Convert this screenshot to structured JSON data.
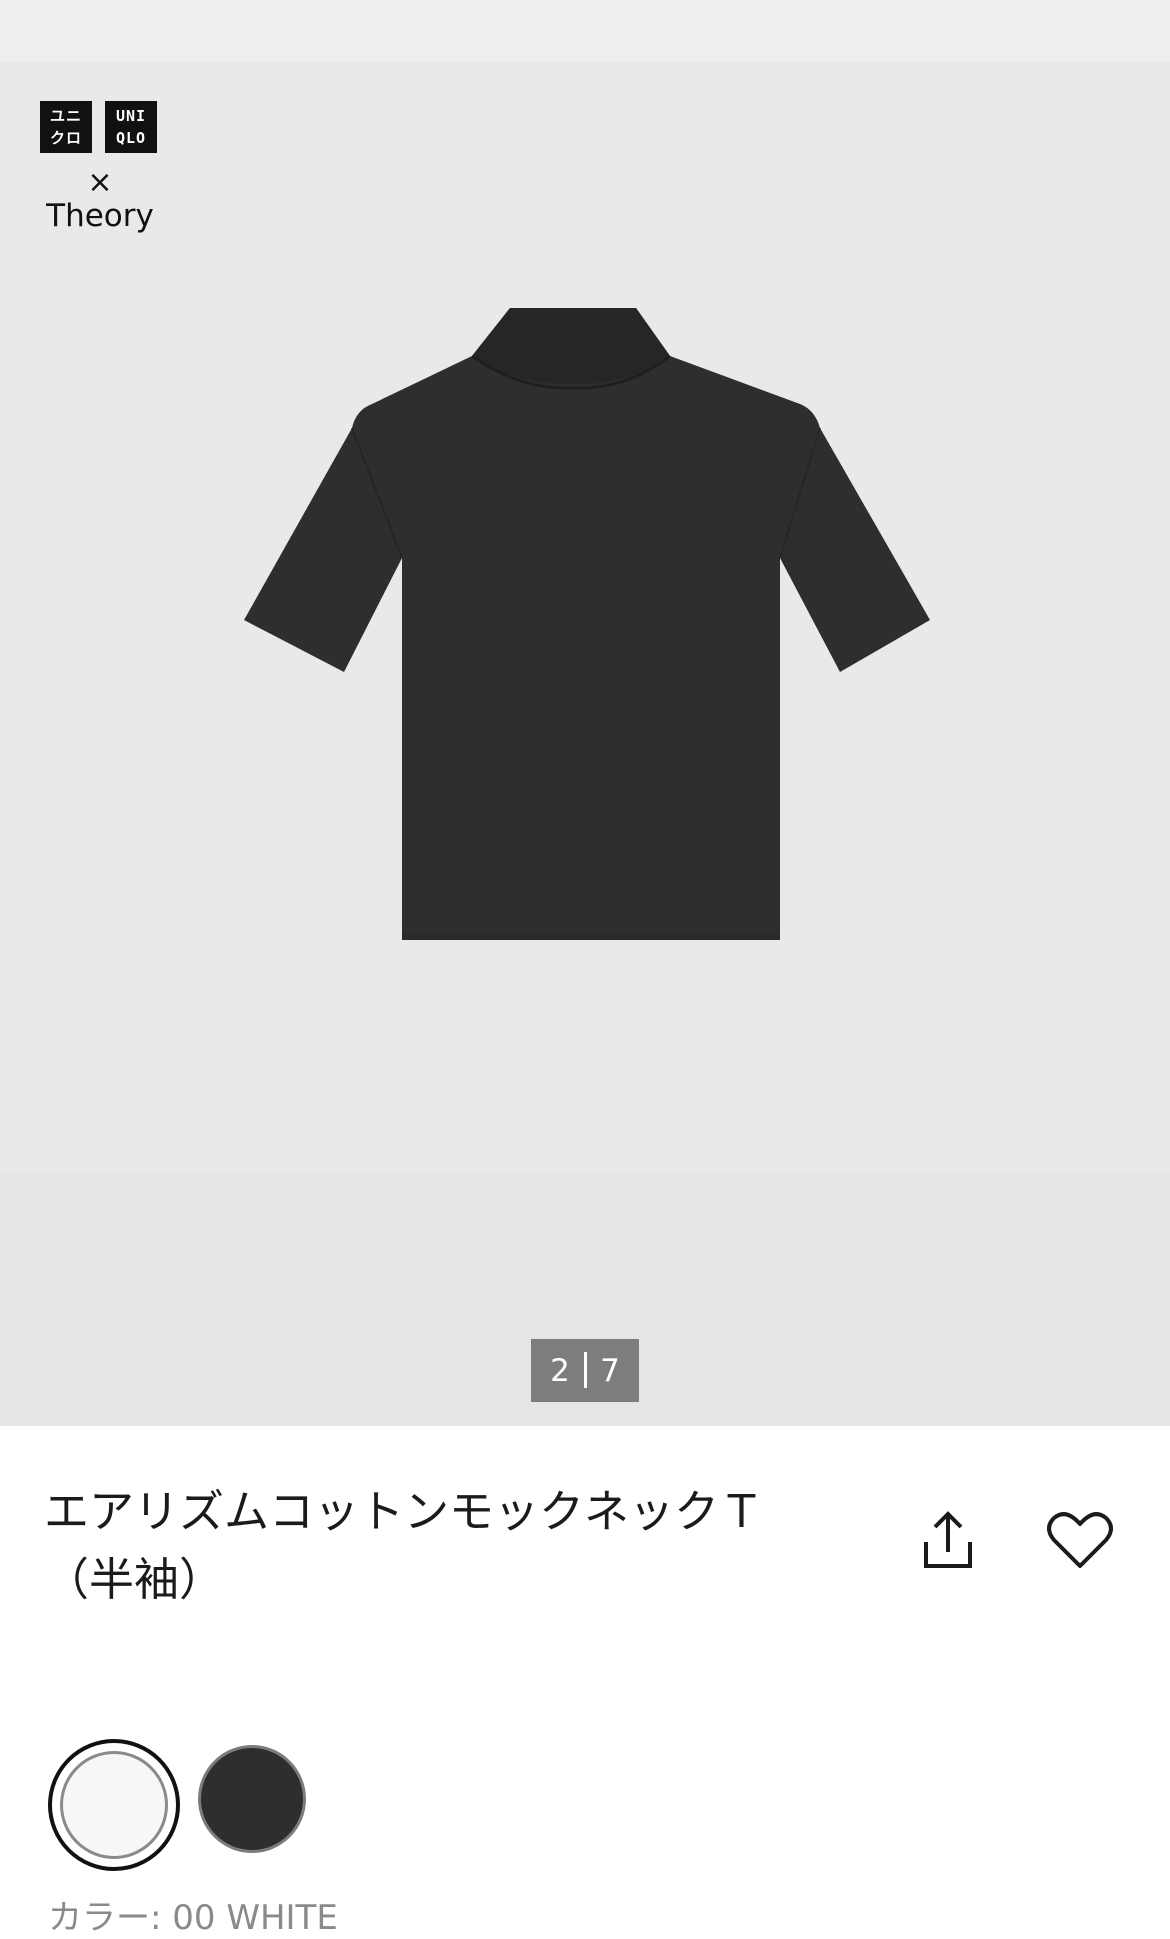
{
  "brand": {
    "logo_left": "ユニ\nクロ",
    "logo_right": "UNI\nQLO",
    "collab_symbol": "×",
    "collab_partner": "Theory"
  },
  "gallery": {
    "current": "2",
    "total": "7",
    "image_icon": "tshirt-image"
  },
  "product": {
    "title": "エアリズムコットンモックネックＴ（半袖）",
    "share_icon": "share-icon",
    "favorite_icon": "heart-icon"
  },
  "colors": {
    "label": "カラー: 00 WHITE",
    "swatches": [
      {
        "name": "WHITE",
        "hex": "#f7f7f7",
        "selected": true
      },
      {
        "name": "BLACK",
        "hex": "#2e2e2e",
        "selected": false
      }
    ]
  }
}
